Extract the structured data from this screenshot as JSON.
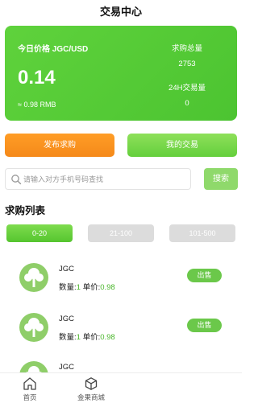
{
  "header": {
    "title": "交易中心"
  },
  "price_card": {
    "label": "今日价格 JGC/USD",
    "price": "0.14",
    "rmb": "≈ 0.98 RMB",
    "total_label": "求购总量",
    "total_value": "2753",
    "volume_label": "24H交易量",
    "volume_value": "0"
  },
  "actions": {
    "publish_label": "发布求购",
    "my_trade_label": "我的交易"
  },
  "search": {
    "placeholder": "请输入对方手机号码查找",
    "button_label": "搜索"
  },
  "list": {
    "title": "求购列表",
    "tabs": [
      {
        "label": "0-20"
      },
      {
        "label": "21-100"
      },
      {
        "label": "101-500"
      }
    ],
    "items": [
      {
        "name": "JGC",
        "qty_label": "数量:",
        "qty": "1",
        "price_label": " 单价:",
        "price": "0.98",
        "sell_label": "出售"
      },
      {
        "name": "JGC",
        "qty_label": "数量:",
        "qty": "1",
        "price_label": " 单价:",
        "price": "0.98",
        "sell_label": "出售"
      },
      {
        "name": "JGC"
      }
    ]
  },
  "tabbar": {
    "home_label": "首页",
    "mall_label": "金果商城"
  },
  "colors": {
    "primary_green": "#5fd23c",
    "orange": "#f5891a",
    "inactive_tab": "#dcdcdc"
  }
}
